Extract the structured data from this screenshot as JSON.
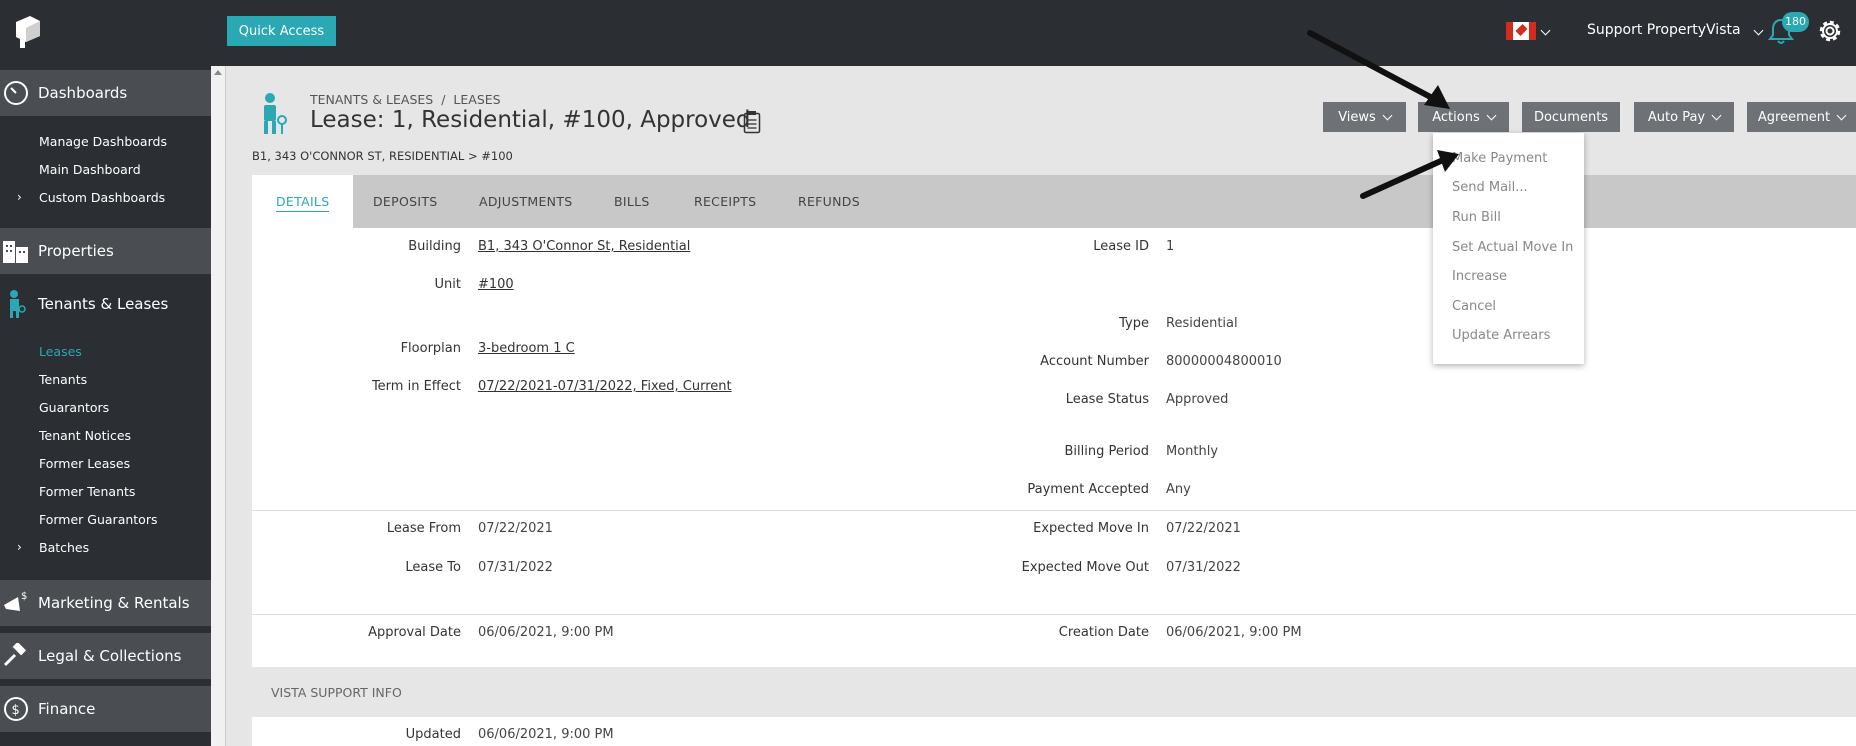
{
  "topbar": {
    "quick_access": "Quick Access",
    "user": "Support PropertyVista",
    "notification_count": "180"
  },
  "sidebar": {
    "sections": [
      {
        "label": "Dashboards",
        "icon": "gauge-icon"
      },
      {
        "label": "Properties",
        "icon": "building-icon"
      },
      {
        "label": "Tenants & Leases",
        "icon": "tenant-icon"
      },
      {
        "label": "Marketing & Rentals",
        "icon": "megaphone-icon"
      },
      {
        "label": "Legal & Collections",
        "icon": "gavel-icon"
      },
      {
        "label": "Finance",
        "icon": "dollar-icon"
      }
    ],
    "dashboards_items": [
      "Manage Dashboards",
      "Main Dashboard",
      "Custom Dashboards"
    ],
    "tenants_items": [
      "Leases",
      "Tenants",
      "Guarantors",
      "Tenant Notices",
      "Former Leases",
      "Former Tenants",
      "Former Guarantors",
      "Batches"
    ]
  },
  "header": {
    "crumb_top_a": "TENANTS & LEASES",
    "crumb_sep": "/",
    "crumb_top_b": "LEASES",
    "title": "Lease: 1, Residential, #100, Approved",
    "crumb_bottom": "B1, 343 O'CONNOR ST, RESIDENTIAL > #100"
  },
  "buttons": {
    "views": "Views",
    "actions": "Actions",
    "documents": "Documents",
    "auto_pay": "Auto Pay",
    "agreement": "Agreement"
  },
  "tabs": [
    "DETAILS",
    "DEPOSITS",
    "ADJUSTMENTS",
    "BILLS",
    "RECEIPTS",
    "REFUNDS"
  ],
  "details": {
    "building_label": "Building",
    "building_value": "B1, 343 O'Connor St, Residential",
    "unit_label": "Unit",
    "unit_value": "#100",
    "floorplan_label": "Floorplan",
    "floorplan_value": "3-bedroom 1 C",
    "term_label": "Term in Effect",
    "term_value": "07/22/2021-07/31/2022, Fixed, Current",
    "lease_id_label": "Lease ID",
    "lease_id_value": "1",
    "type_label": "Type",
    "type_value": "Residential",
    "account_label": "Account Number",
    "account_value": "80000004800010",
    "status_label": "Lease Status",
    "status_value": "Approved",
    "billing_label": "Billing Period",
    "billing_value": "Monthly",
    "payment_label": "Payment Accepted",
    "payment_value": "Any",
    "lease_from_label": "Lease From",
    "lease_from_value": "07/22/2021",
    "lease_to_label": "Lease To",
    "lease_to_value": "07/31/2022",
    "move_in_label": "Expected Move In",
    "move_in_value": "07/22/2021",
    "move_out_label": "Expected Move Out",
    "move_out_value": "07/31/2022",
    "approval_label": "Approval Date",
    "approval_value": "06/06/2021, 9:00 PM",
    "creation_label": "Creation Date",
    "creation_value": "06/06/2021, 9:00 PM",
    "vsi_header": "VISTA SUPPORT INFO",
    "updated_label": "Updated",
    "updated_value": "06/06/2021, 9:00 PM"
  },
  "actions_menu": [
    "Make Payment",
    "Send Mail...",
    "Run Bill",
    "Set Actual Move In",
    "Increase",
    "Cancel",
    "Update Arrears"
  ],
  "colors": {
    "accent": "#2aa8b3",
    "dark": "#2b2e33",
    "button": "#6e7176"
  }
}
